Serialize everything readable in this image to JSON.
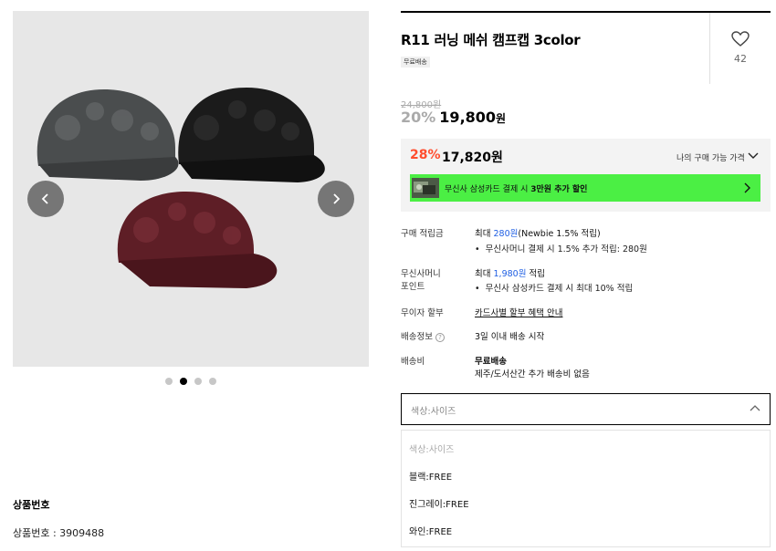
{
  "product": {
    "title": "R11 러닝 메쉬 캠프캡 3color",
    "badge": "무료배송",
    "likes": "42",
    "original_price": "24,800원",
    "discount_pct": "20%",
    "price": "19,800",
    "price_unit": "원",
    "number_section_title": "상품번호",
    "number_text": "상품번호 : 3909488"
  },
  "gallery": {
    "current_index": 2,
    "total": 4,
    "prev_icon": "chevron-left-icon",
    "next_icon": "chevron-right-icon",
    "colors": {
      "gray": "#4a4d4e",
      "black": "#1b1b1b",
      "wine": "#5e1e26"
    }
  },
  "my_price": {
    "pct": "28%",
    "price": "17,820원",
    "label": "나의 구매 가능 가격",
    "promo_prefix": "무신사 삼성카드 결제 시 ",
    "promo_bold": "3만원 추가 할인"
  },
  "info": {
    "points_label": "구매 적립금",
    "points_prefix": "최대 ",
    "points_amount": "280원",
    "points_suffix": "(Newbie 1.5% 적립)",
    "points_bullet": "무신사머니 결제 시 1.5% 추가 적립: 280원",
    "money_label_1": "무신사머니",
    "money_label_2": "포인트",
    "money_prefix": "최대 ",
    "money_amount": "1,980원",
    "money_suffix": " 적립",
    "money_bullet": "무신사 삼성카드 결제 시 최대 10% 적립",
    "installment_label": "무이자 할부",
    "installment_link": "카드사별 할부 혜택 안내",
    "shipping_label": "배송정보",
    "shipping_help": "?",
    "shipping_value": "3일 이내 배송 시작",
    "fee_label": "배송비",
    "fee_value": "무료배송",
    "fee_note": "제주/도서산간 추가 배송비 없음"
  },
  "option_select": {
    "placeholder": "색상:사이즈",
    "options": [
      "색상:사이즈",
      "블랙:FREE",
      "진그레이:FREE",
      "와인:FREE"
    ]
  },
  "colors": {
    "accent_red": "#ff4d2e",
    "link_blue": "#1e5ee3",
    "promo_green": "#4bef44"
  }
}
